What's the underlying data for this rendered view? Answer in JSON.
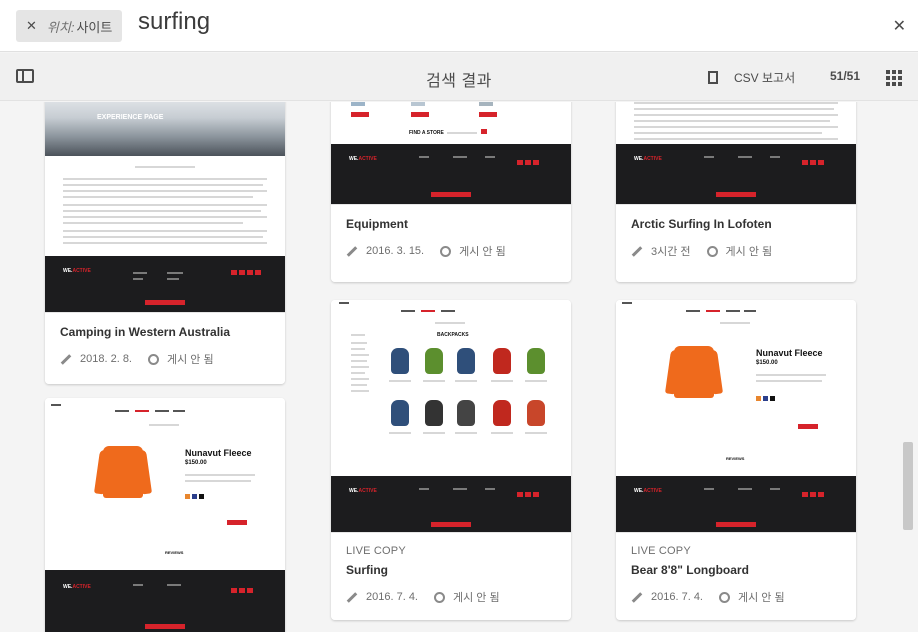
{
  "search": {
    "tag_key": "위치:",
    "tag_value": "사이트",
    "query": "surfing"
  },
  "actionbar": {
    "title": "검색 결과",
    "csv_label": "CSV 보고서",
    "count": "51/51"
  },
  "cards": [
    {
      "live_copy": "",
      "title": "Camping in Western Australia",
      "date": "2018. 2. 8.",
      "status": "게시 안 됨",
      "thumb_heading": "EXPERIENCE PAGE"
    },
    {
      "live_copy": "",
      "title": "Equipment",
      "date": "2016. 3. 15.",
      "status": "게시 안 됨",
      "thumb_heading": "FIND A STORE"
    },
    {
      "live_copy": "",
      "title": "Arctic Surfing In Lofoten",
      "date": "3시간 전",
      "status": "게시 안 됨"
    },
    {
      "live_copy": "",
      "title": "",
      "date": "",
      "status": "",
      "thumb_heading": "Nunavut Fleece",
      "thumb_price": "$150.00"
    },
    {
      "live_copy": "LIVE COPY",
      "title": "Surfing",
      "date": "2016. 7. 4.",
      "status": "게시 안 됨",
      "thumb_heading": "BACKPACKS"
    },
    {
      "live_copy": "LIVE COPY",
      "title": "Bear 8'8\" Longboard",
      "date": "2016. 7. 4.",
      "status": "게시 안 됨",
      "thumb_heading": "Nunavut Fleece",
      "thumb_price": "$150.00"
    }
  ],
  "thumb_brand": {
    "we": "WE.",
    "retail": "ACTIVE"
  },
  "colors": {
    "accent_red": "#d6232b",
    "footer_dark": "#1c1c1e",
    "jacket_orange": "#ef6a1c"
  },
  "icons": [
    "close-icon",
    "rail-toggle-icon",
    "csv-file-icon",
    "grid-view-icon",
    "pencil-icon",
    "globe-icon"
  ]
}
